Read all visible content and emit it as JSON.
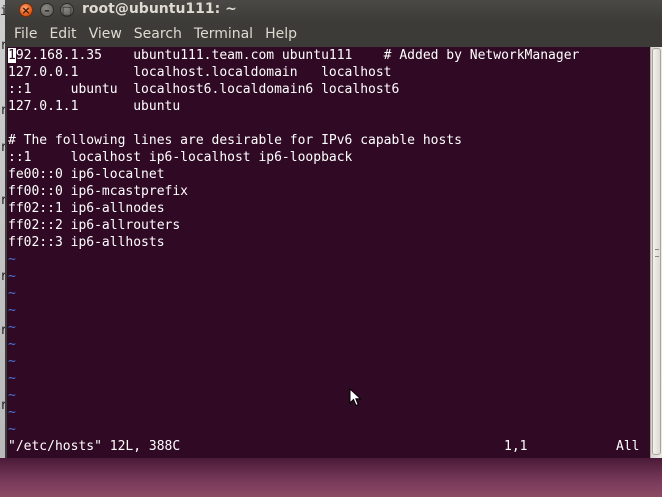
{
  "window": {
    "title": "root@ubuntu111: ~",
    "close_glyph": "×",
    "minimize_glyph": "–",
    "maximize_glyph": "□"
  },
  "menubar": {
    "items": [
      "File",
      "Edit",
      "View",
      "Search",
      "Terminal",
      "Help"
    ]
  },
  "terminal": {
    "cursor_char": "1",
    "lines": [
      "92.168.1.35    ubuntu111.team.com ubuntu111    # Added by NetworkManager",
      "127.0.0.1       localhost.localdomain   localhost",
      "::1     ubuntu  localhost6.localdomain6 localhost6",
      "127.0.1.1       ubuntu",
      "",
      "# The following lines are desirable for IPv6 capable hosts",
      "::1     localhost ip6-localhost ip6-loopback",
      "fe00::0 ip6-localnet",
      "ff00::0 ip6-mcastprefix",
      "ff02::1 ip6-allnodes",
      "ff02::2 ip6-allrouters",
      "ff02::3 ip6-allhosts"
    ],
    "tilde": "~",
    "status": {
      "file": "\"/etc/hosts\" 12L, 388C",
      "position": "1,1",
      "scroll": "All"
    }
  },
  "desktop": {
    "left_glyphs": [
      "il",
      "r",
      "r",
      "r",
      "r",
      "r",
      "r",
      "r"
    ]
  },
  "colors": {
    "terminal_bg": "#300a24",
    "tilde": "#4a74d8",
    "close_button": "#e8601c"
  }
}
